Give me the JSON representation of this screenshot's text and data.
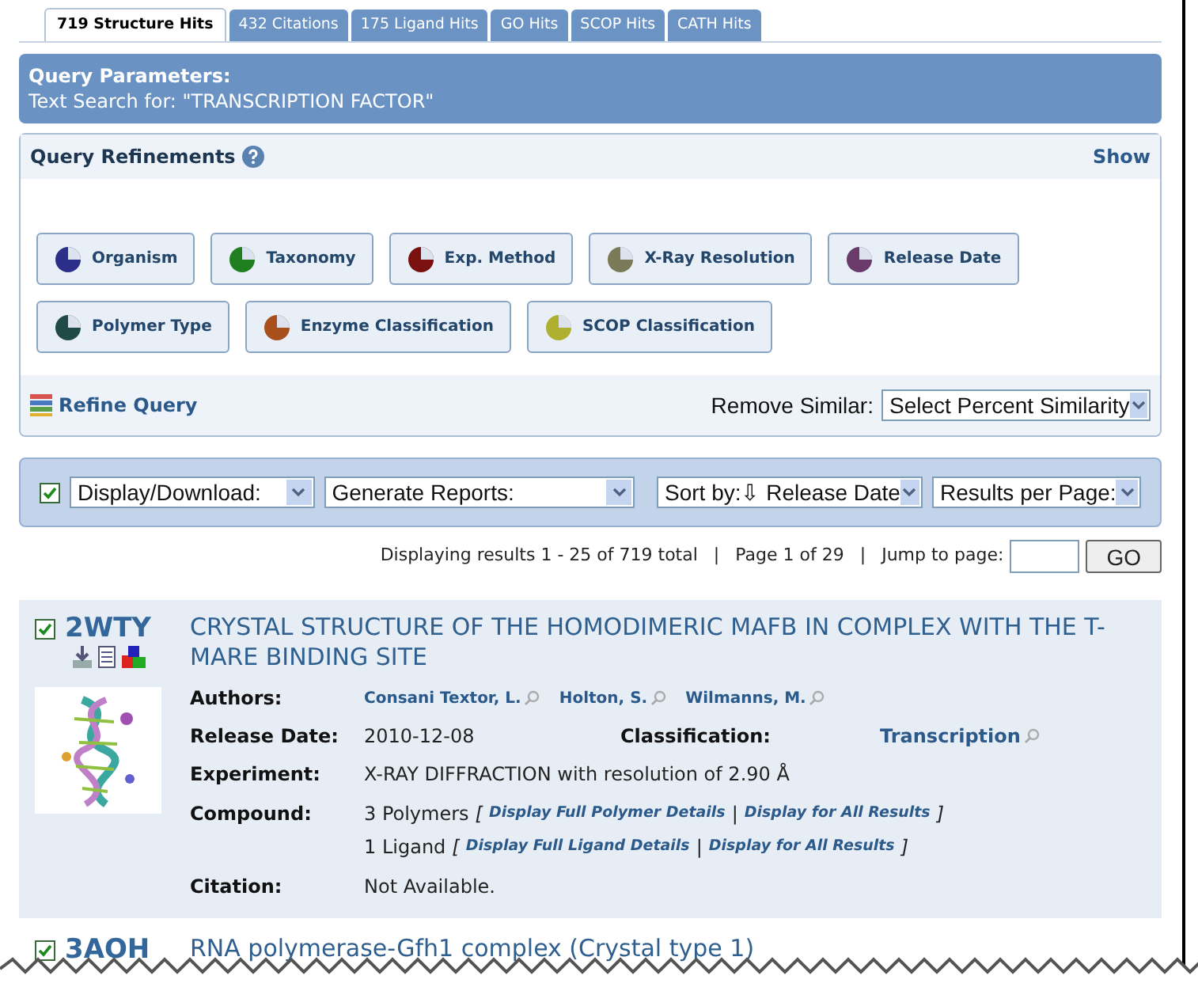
{
  "tabs": [
    {
      "label": "719 Structure Hits",
      "selected": true
    },
    {
      "label": "432 Citations",
      "selected": false
    },
    {
      "label": "175 Ligand Hits",
      "selected": false
    },
    {
      "label": "GO Hits",
      "selected": false
    },
    {
      "label": "SCOP Hits",
      "selected": false
    },
    {
      "label": "CATH Hits",
      "selected": false
    }
  ],
  "query": {
    "heading": "Query Parameters:",
    "text": "Text Search for: \"TRANSCRIPTION FACTOR\""
  },
  "refinements": {
    "title": "Query Refinements",
    "show": "Show",
    "buttons": [
      {
        "label": "Organism",
        "color": "#2b2f8a"
      },
      {
        "label": "Taxonomy",
        "color": "#1f7f1f"
      },
      {
        "label": "Exp. Method",
        "color": "#7a1010"
      },
      {
        "label": "X-Ray Resolution",
        "color": "#7a7a58"
      },
      {
        "label": "Release Date",
        "color": "#6a3a6a"
      },
      {
        "label": "Polymer Type",
        "color": "#1f4a45"
      },
      {
        "label": "Enzyme Classification",
        "color": "#a8501c"
      },
      {
        "label": "SCOP Classification",
        "color": "#b0b030"
      }
    ],
    "refine_query": "Refine Query",
    "remove_similar_label": "Remove Similar:",
    "similarity_select": "Select Percent Similarity"
  },
  "toolbar": {
    "checked": true,
    "selects": [
      "Display/Download:",
      "Generate Reports:",
      "Sort by:⇩ Release Date",
      "Results per Page:"
    ]
  },
  "paging": {
    "summary": "Displaying results 1 - 25 of 719 total",
    "sep": "|",
    "page": "Page 1 of 29",
    "sep2": "|",
    "jump_label": "Jump to page:",
    "go": "GO"
  },
  "results": [
    {
      "id": "2WTY",
      "checked": true,
      "title": "CRYSTAL STRUCTURE OF THE HOMODIMERIC MAFB IN COMPLEX WITH THE T-MARE BINDING SITE",
      "fields": [
        {
          "kind": "authors",
          "label": "Authors:",
          "authors": [
            "Consani Textor, L.",
            "Holton, S.",
            "Wilmanns, M."
          ]
        },
        {
          "kind": "pair",
          "label": "Release Date:",
          "value": "2010-12-08",
          "label2": "Classification:",
          "value2": "Transcription"
        },
        {
          "kind": "text",
          "label": "Experiment:",
          "value": "X-RAY DIFFRACTION with resolution of 2.90 Å"
        },
        {
          "kind": "compound",
          "label": "Compound:",
          "lines": [
            {
              "count": "3 Polymers",
              "open": "[",
              "links": [
                "Display Full Polymer Details",
                "Display for All Results"
              ],
              "sep": "|",
              "close": "]"
            },
            {
              "count": "1 Ligand",
              "open": "[",
              "links": [
                "Display Full Ligand Details",
                "Display for All Results"
              ],
              "sep": "|",
              "close": "]"
            }
          ]
        },
        {
          "kind": "text",
          "label": "Citation:",
          "value": "Not Available."
        }
      ]
    },
    {
      "id": "3AOH",
      "checked": true,
      "title": "RNA polymerase-Gfh1 complex (Crystal type 1)"
    }
  ]
}
